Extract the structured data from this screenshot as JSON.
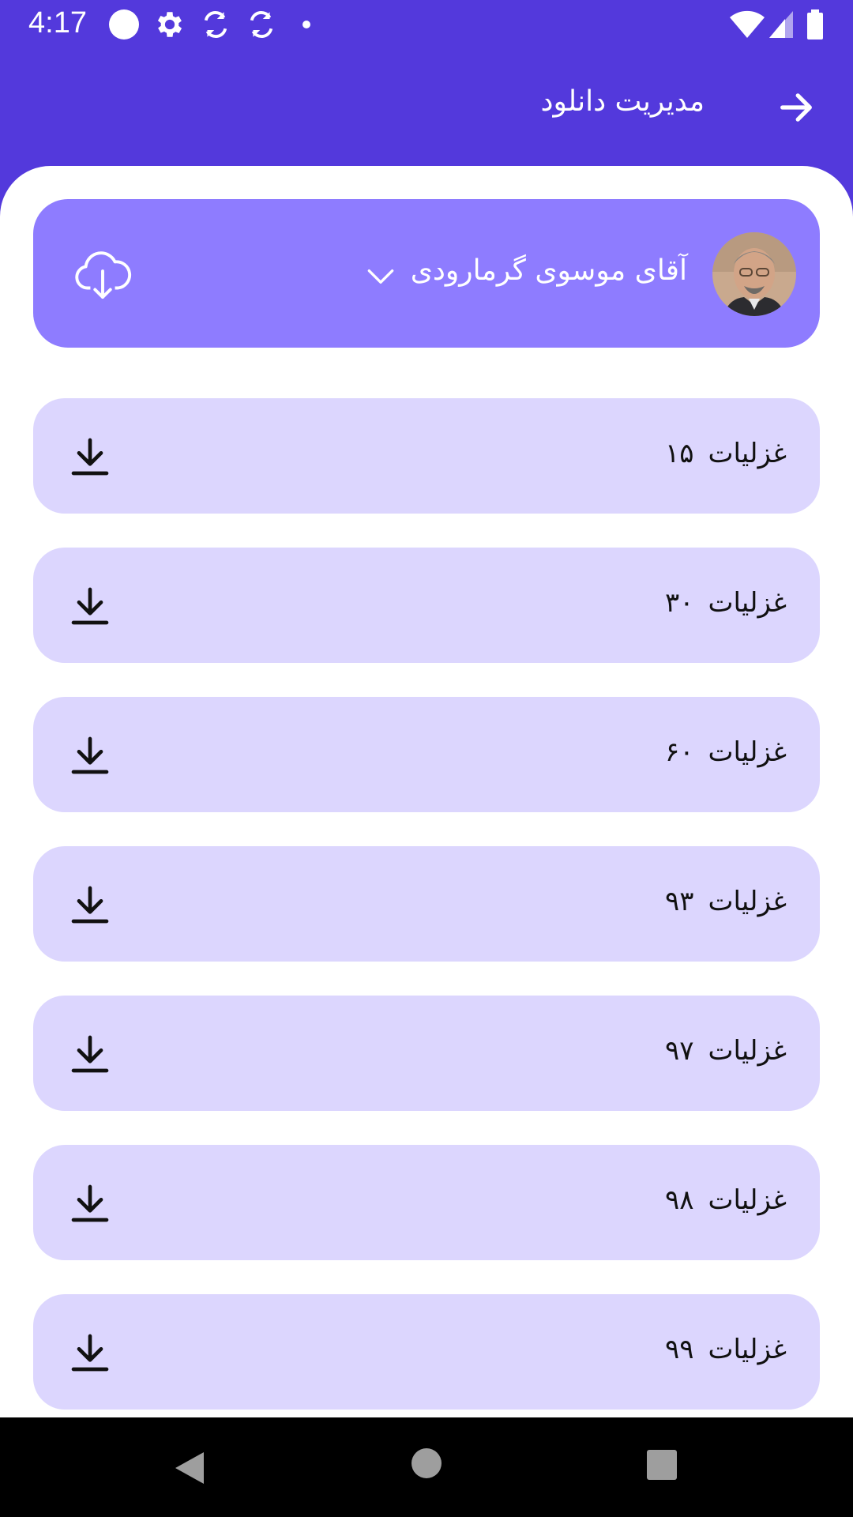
{
  "status_bar": {
    "time": "4:17",
    "icons": [
      "circle-icon",
      "gear-icon",
      "sync-icon",
      "sync-icon",
      "dot-icon"
    ],
    "right_icons": [
      "wifi-icon",
      "signal-icon",
      "battery-icon"
    ]
  },
  "header": {
    "title": "مدیریت دانلود",
    "back_icon": "arrow-right-icon"
  },
  "poet": {
    "name": "آقای موسوی گرمارودی",
    "avatar": "poet-avatar",
    "dropdown_icon": "chevron-down-icon",
    "download_all_icon": "cloud-download-icon"
  },
  "items": [
    {
      "title": "غزلیات",
      "number": "۱۵"
    },
    {
      "title": "غزلیات",
      "number": "۳۰"
    },
    {
      "title": "غزلیات",
      "number": "۶۰"
    },
    {
      "title": "غزلیات",
      "number": "۹۳"
    },
    {
      "title": "غزلیات",
      "number": "۹۷"
    },
    {
      "title": "غزلیات",
      "number": "۹۸"
    },
    {
      "title": "غزلیات",
      "number": "۹۹"
    }
  ],
  "colors": {
    "primary": "#5339DC",
    "card": "#8E7CFF",
    "item_bg": "#DCD6FE",
    "nav_bg": "#000000"
  }
}
